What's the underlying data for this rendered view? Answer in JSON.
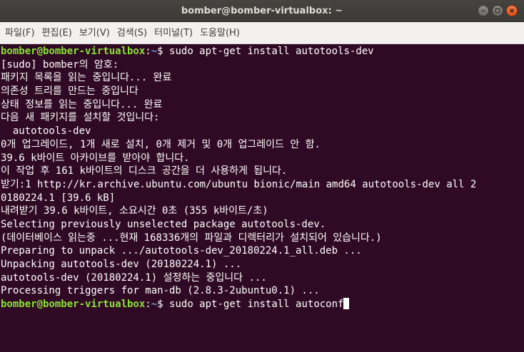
{
  "window": {
    "title": "bomber@bomber-virtualbox: ~"
  },
  "menu": [
    "파일(F)",
    "편집(E)",
    "보기(V)",
    "검색(S)",
    "터미널(T)",
    "도움말(H)"
  ],
  "prompt": {
    "user_host": "bomber@bomber-virtualbox",
    "colon": ":",
    "path": "~",
    "symbol": "$ "
  },
  "commands": {
    "first": "sudo apt-get install autotools-dev",
    "current": "sudo apt-get install autoconf"
  },
  "output": [
    "[sudo] bomber의 암호:",
    "패키지 목록을 읽는 중입니다... 완료",
    "의존성 트리를 만드는 중입니다",
    "상태 정보를 읽는 중입니다... 완료",
    "다음 새 패키지를 설치할 것입니다:",
    "  autotools-dev",
    "0개 업그레이드, 1개 새로 설치, 0개 제거 및 0개 업그레이드 안 함.",
    "39.6 k바이트 아카이브를 받아야 합니다.",
    "이 작업 후 161 k바이트의 디스크 공간을 더 사용하게 됩니다.",
    "받기:1 http://kr.archive.ubuntu.com/ubuntu bionic/main amd64 autotools-dev all 2",
    "0180224.1 [39.6 kB]",
    "내려받기 39.6 k바이트, 소요시간 0초 (355 k바이트/초)",
    "Selecting previously unselected package autotools-dev.",
    "(데이터베이스 읽는중 ...현재 168336개의 파일과 디렉터리가 설치되어 있습니다.)",
    "Preparing to unpack .../autotools-dev_20180224.1_all.deb ...",
    "Unpacking autotools-dev (20180224.1) ...",
    "autotools-dev (20180224.1) 설정하는 중입니다 ...",
    "Processing triggers for man-db (2.8.3-2ubuntu0.1) ..."
  ],
  "colors": {
    "background": "#300a24",
    "prompt_user": "#8ae234",
    "prompt_path": "#729fcf",
    "text": "#ffffff"
  },
  "icons": {
    "minimize": "minimize-icon",
    "maximize": "maximize-icon",
    "close": "close-icon"
  }
}
